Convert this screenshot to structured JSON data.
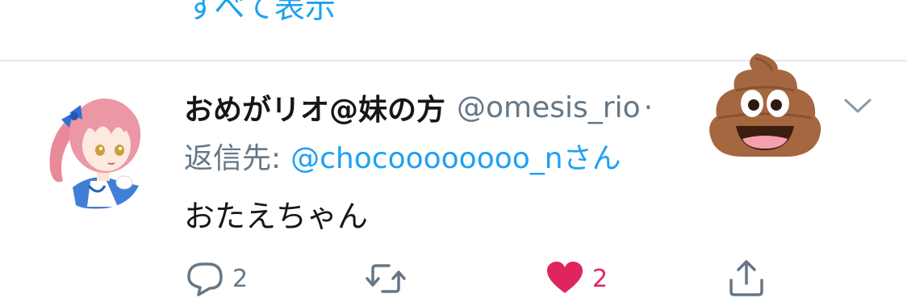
{
  "top": {
    "show_all_label": "すべて表示"
  },
  "tweet": {
    "display_name": "おめがリオ@妹の方",
    "handle": "@omesis_rio",
    "dot": "·",
    "reply_label": "返信先:",
    "reply_target": "@chocoooooooo_nさん",
    "text": "おたえちゃん"
  },
  "actions": {
    "reply": {
      "icon": "reply-icon",
      "count": "2"
    },
    "retweet": {
      "icon": "retweet-icon"
    },
    "like": {
      "icon": "heart-icon",
      "count": "2",
      "active": true
    },
    "share": {
      "icon": "share-icon"
    }
  },
  "colors": {
    "link": "#1da1f2",
    "secondary": "#657786",
    "primary": "#14171a",
    "like": "#e0245e"
  }
}
